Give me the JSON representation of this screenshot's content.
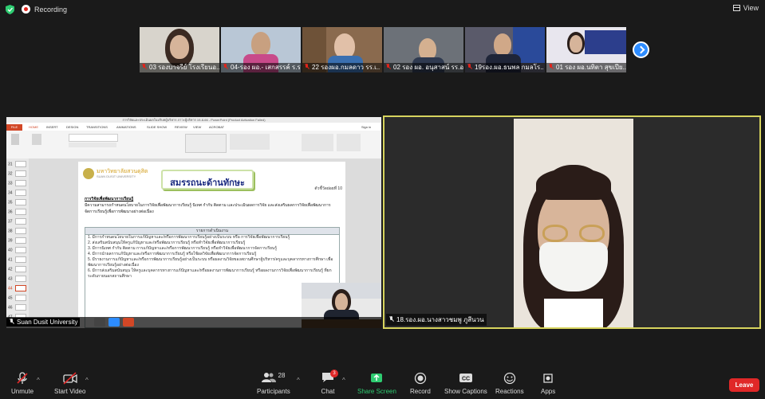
{
  "topbar": {
    "recording_label": "Recording",
    "view_label": "View"
  },
  "participants_strip": [
    {
      "name": "03 รองบาจรีย์ โรงเรียนอ.."
    },
    {
      "name": "04-รอง ผอ.- เสกสรรค์ ร.ร.."
    },
    {
      "name": "22 รองผอ.กมลดาว รร.เ.."
    },
    {
      "name": "02 รอง ผอ. อนุสาสน์ รร.อ.."
    },
    {
      "name": "19รอง.ผอ.ธนพล กมลโร.."
    },
    {
      "name": "01 รอง ผอ.นทิตา สุขเปีย.."
    }
  ],
  "shared_screen": {
    "app_title": "การวิจัยและประเมินผลในบริบทผู้บริหาร ภาวะผู้บริหาร 19-8-66 - PowerPoint (Product Activation Failed)",
    "tabs": [
      "FILE",
      "HOME",
      "INSERT",
      "DESIGN",
      "TRANSITIONS",
      "ANIMATIONS",
      "SLIDE SHOW",
      "REVIEW",
      "VIEW",
      "ACROBAT"
    ],
    "sign_in": "Sign in",
    "slide_numbers": [
      "31",
      "32",
      "33",
      "34",
      "35",
      "36",
      "37",
      "38",
      "39",
      "40",
      "41",
      "42",
      "43",
      "44",
      "45",
      "46",
      "47"
    ],
    "slide": {
      "logo_text": "มหาวิทยาลัยสวนดุสิต",
      "logo_sub": "SUAN DUSIT UNIVERSITY",
      "title": "สมรรถนะด้านทักษะ",
      "indicator": "ตัวชี้วัดย่อยที่ 10",
      "heading": "การวิจัยเพื่อพัฒนาการเรียนรู้",
      "paragraph": "มีความสามารถกำหนดนโยบายในการวิจัยเพื่อพัฒนาการเรียนรู้ นิเทศ กำกับ ติดตาม และประเมินผลการวิจัย และส่งเสริมผลการวิจัยเพื่อพัฒนาการจัดการเรียนรู้เพื่อการพัฒนาอย่างต่อเนื่อง",
      "table_header": "รายการดำเนินงาน",
      "table_items": [
        "1. มีการกำหนดนโยบายในการแก้ปัญหาและ/หรือการพัฒนาการเรียนรู้อย่างเป็นระบบ หรือ การวิจัยเพื่อพัฒนาการเรียนรู้",
        "2. ส่งเสริมสนับสนุนให้ครูแก้ปัญหาและ/หรือพัฒนาการเรียนรู้ หรือทำวิจัยเพื่อพัฒนาการเรียนรู้",
        "3. มีการนิเทศ กำกับ ติดตาม การแก้ปัญหาและ/หรือการพัฒนาการเรียนรู้ หรือทำวิจัยเพื่อพัฒนาการจัดการเรียนรู้",
        "4. มีการนำผลการแก้ปัญหาและ/หรือการพัฒนาการเรียนรู้ หรือใช้ผลวิจัยเพื่อพัฒนาการจัดการเรียนรู้",
        "5. มีรายงานการแก้ปัญหาและ/หรือการพัฒนาการเรียนรู้อย่างเป็นระบบ หรือผลงานวิจัยของสถานศึกษาผู้บริหาร/ครูและบุคลากรทางการศึกษา เพื่อพัฒนาการเรียนรู้อย่างต่อเนื่อง",
        "6. มีการส่งเสริมสนับสนุน ให้ครูและบุคลากรทางการแก้ปัญหาและ/หรือผลงานการพัฒนาการเรียนรู้ หรือผลงานการวิจัยเพื่อพัฒนาการเรียนรู้ ที่ยกระดับภายนอกสถานศึกษา"
      ]
    },
    "presenter_name": "Suan Dusit University"
  },
  "main_video": {
    "name": "18.รอง.ผอ.นางสาวชมพู ภูสีนวน"
  },
  "toolbar": {
    "unmute": "Unmute",
    "start_video": "Start Video",
    "participants": "Participants",
    "participants_count": "28",
    "chat": "Chat",
    "chat_badge": "3",
    "share_screen": "Share Screen",
    "record": "Record",
    "show_captions": "Show Captions",
    "reactions": "Reactions",
    "apps": "Apps",
    "leave": "Leave"
  },
  "colors": {
    "accent": "#2d8cff",
    "share_green": "#2ecc71",
    "leave_red": "#e02828",
    "active_speaker": "#d7d45e"
  }
}
